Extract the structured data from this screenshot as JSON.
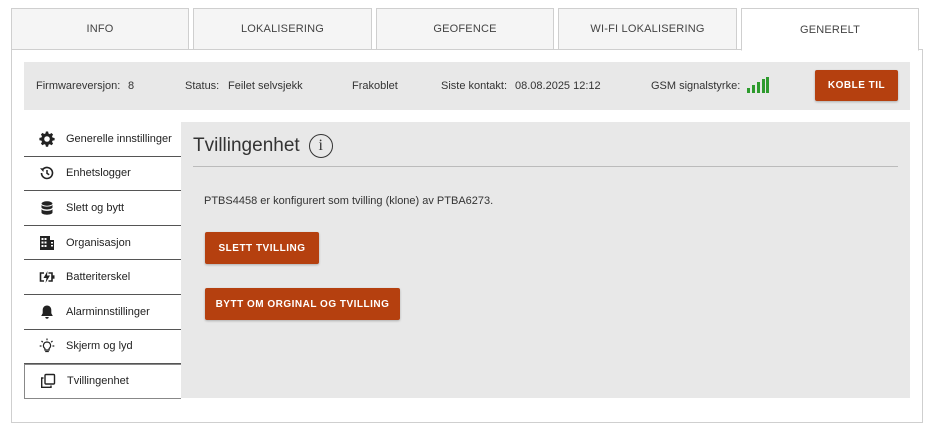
{
  "tabs": [
    {
      "label": "INFO"
    },
    {
      "label": "LOKALISERING"
    },
    {
      "label": "GEOFENCE"
    },
    {
      "label": "WI-FI LOKALISERING"
    },
    {
      "label": "GENERELT",
      "active": true
    }
  ],
  "status": {
    "firmware_label": "Firmwareversjon:",
    "firmware_value": "8",
    "status_label": "Status:",
    "status_value": "Feilet selvsjekk",
    "connection": "Frakoblet",
    "last_contact_label": "Siste kontakt:",
    "last_contact_value": "08.08.2025 12:12",
    "gsm_label": "GSM signalstyrke:",
    "gsm_icon": "signal-bars-icon",
    "gsm_color": "#2e9b2e",
    "connect_button": "KOBLE TIL"
  },
  "sidebar": {
    "items": [
      {
        "label": "Generelle innstillinger",
        "icon": "gear-icon"
      },
      {
        "label": "Enhetslogger",
        "icon": "history-icon"
      },
      {
        "label": "Slett og bytt",
        "icon": "database-icon"
      },
      {
        "label": "Organisasjon",
        "icon": "building-icon"
      },
      {
        "label": "Batteriterskel",
        "icon": "battery-charging-icon"
      },
      {
        "label": "Alarminnstillinger",
        "icon": "bell-icon"
      },
      {
        "label": "Skjerm og lyd",
        "icon": "lightbulb-icon"
      },
      {
        "label": "Tvillingenhet",
        "icon": "copy-icon",
        "active": true
      }
    ]
  },
  "main": {
    "title": "Tvillingenhet",
    "info_icon": "i",
    "description": "PTBS4458 er konfigurert som tvilling (klone) av PTBA6273.",
    "delete_button": "SLETT TVILLING",
    "swap_button": "BYTT OM ORGINAL OG TVILLING"
  },
  "colors": {
    "accent": "#b5400f",
    "panel": "#e8e8e8",
    "signal": "#2e9b2e"
  }
}
